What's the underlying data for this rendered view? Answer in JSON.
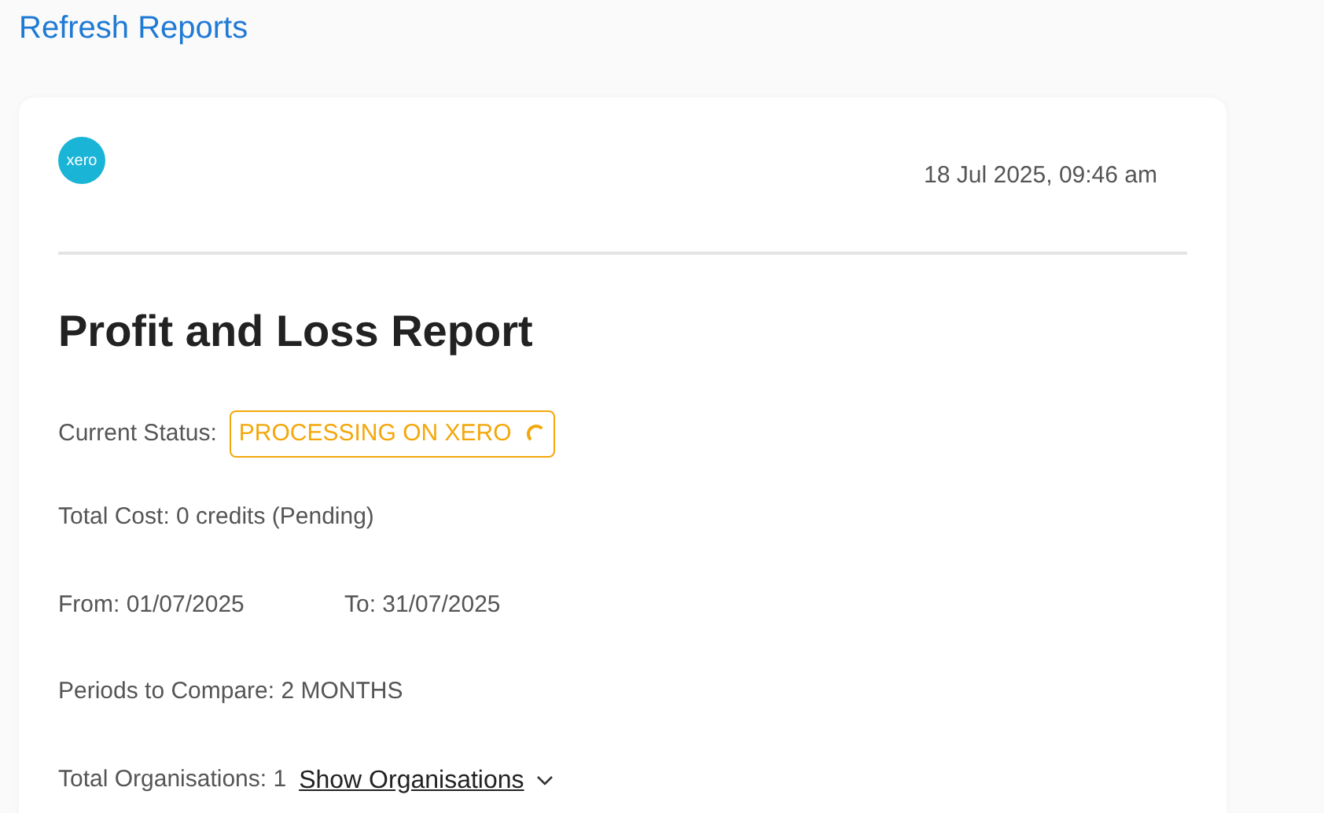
{
  "page_title": "Refresh Reports",
  "report": {
    "logo_text": "xero",
    "timestamp": "18 Jul 2025, 09:46 am",
    "title": "Profit and Loss Report",
    "status": {
      "label": "Current Status:",
      "value": "PROCESSING ON XERO",
      "loading": true
    },
    "total_cost": "Total Cost: 0 credits (Pending)",
    "from": "From: 01/07/2025",
    "to": "To: 31/07/2025",
    "periods": "Periods to Compare: 2 MONTHS",
    "organisations": {
      "label": "Total Organisations: 1",
      "toggle": "Show Organisations",
      "expanded": false
    }
  }
}
